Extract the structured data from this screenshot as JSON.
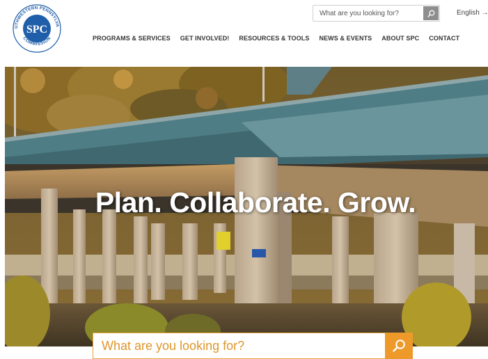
{
  "logo": {
    "initials": "SPC",
    "ring_text_top": "SOUTHWESTERN PENNSYLVANIA",
    "ring_text_bottom": "COMMISSION",
    "colors": {
      "primary": "#1f5ea8",
      "ring_text": "#1f5ea8"
    }
  },
  "header": {
    "search": {
      "placeholder": "What are you looking for?",
      "icon": "search-icon"
    },
    "language": "English →"
  },
  "nav": {
    "items": [
      {
        "label": "PROGRAMS & SERVICES"
      },
      {
        "label": "GET INVOLVED!"
      },
      {
        "label": "RESOURCES & TOOLS"
      },
      {
        "label": "NEWS & EVENTS"
      },
      {
        "label": "ABOUT SPC"
      },
      {
        "label": "CONTACT"
      }
    ]
  },
  "hero": {
    "headline": "Plan. Collaborate. Grow.",
    "image": "highway-bridge-photo"
  },
  "main_search": {
    "placeholder": "What are you looking for?",
    "icon": "search-icon",
    "colors": {
      "accent": "#ed9a2b",
      "placeholder": "#e0962a"
    }
  }
}
